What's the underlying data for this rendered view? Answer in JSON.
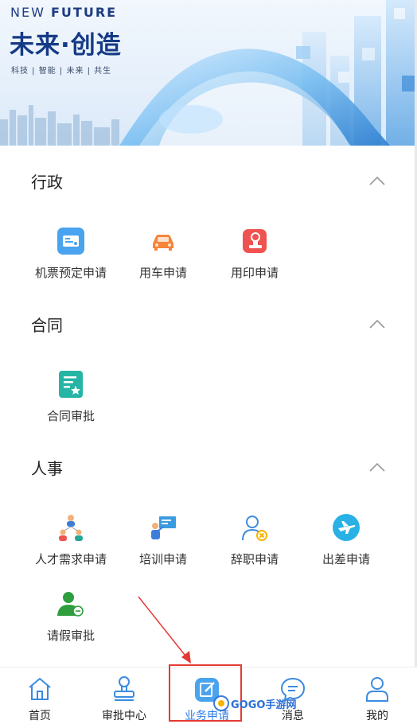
{
  "banner": {
    "en_title_plain": "NEW ",
    "en_title_bold": "FUTURE",
    "cn_title": "未来·创造",
    "tagline": "科技 | 智能 | 未来 | 共生"
  },
  "sections": [
    {
      "title": "行政",
      "items": [
        {
          "label": "机票预定申请",
          "icon": "air-ticket-icon"
        },
        {
          "label": "用车申请",
          "icon": "car-icon"
        },
        {
          "label": "用印申请",
          "icon": "seal-icon"
        }
      ]
    },
    {
      "title": "合同",
      "items": [
        {
          "label": "合同审批",
          "icon": "contract-icon"
        }
      ]
    },
    {
      "title": "人事",
      "items": [
        {
          "label": "人才需求申请",
          "icon": "talent-icon"
        },
        {
          "label": "培训申请",
          "icon": "training-icon"
        },
        {
          "label": "辞职申请",
          "icon": "resign-icon"
        },
        {
          "label": "出差申请",
          "icon": "plane-icon"
        },
        {
          "label": "请假审批",
          "icon": "leave-icon"
        }
      ]
    }
  ],
  "nav": [
    {
      "label": "首页",
      "icon": "home-icon"
    },
    {
      "label": "审批中心",
      "icon": "stamp-icon"
    },
    {
      "label": "业务申请",
      "icon": "edit-icon",
      "active": true
    },
    {
      "label": "消息",
      "icon": "message-icon"
    },
    {
      "label": "我的",
      "icon": "user-icon"
    }
  ],
  "watermark": "GOGO手游网",
  "colors": {
    "accent": "#2d7be5",
    "annotation": "#e53935",
    "brand_dark": "#153a86"
  }
}
